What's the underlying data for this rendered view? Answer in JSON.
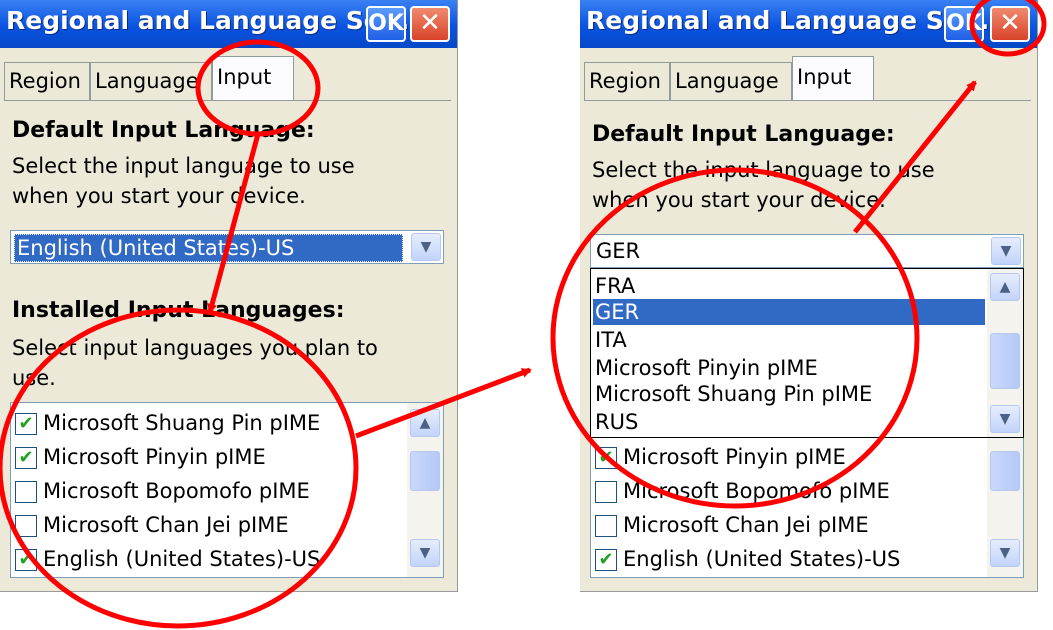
{
  "left": {
    "title": "Regional and Language Se...",
    "ok_label": "OK",
    "close_glyph": "✕",
    "tabs": [
      {
        "label": "Region"
      },
      {
        "label": "Language"
      },
      {
        "label": "Input"
      }
    ],
    "default_heading": "Default Input Language:",
    "default_desc_1": "Select the input language to use",
    "default_desc_2": "when you start your device.",
    "combo_value": "English (United States)-US",
    "installed_heading": "Installed Input Languages:",
    "installed_desc_1": "Select input languages you plan to",
    "installed_desc_2": "use.",
    "items": [
      {
        "label": "Microsoft Shuang Pin pIME",
        "checked": "✔"
      },
      {
        "label": "Microsoft Pinyin pIME",
        "checked": "✔"
      },
      {
        "label": "Microsoft Bopomofo pIME",
        "checked": ""
      },
      {
        "label": "Microsoft Chan Jei pIME",
        "checked": ""
      },
      {
        "label": "English (United States)-US",
        "checked": "✔"
      }
    ]
  },
  "right": {
    "title": "Regional and Language Se...",
    "ok_label": "OK",
    "close_glyph": "✕",
    "tabs": [
      {
        "label": "Region"
      },
      {
        "label": "Language"
      },
      {
        "label": "Input"
      }
    ],
    "default_heading": "Default Input Language:",
    "default_desc_1": "Select the input language to use",
    "default_desc_2": "when you start your device.",
    "combo_value": "GER",
    "dropdown_options": [
      {
        "label": "FRA"
      },
      {
        "label": "GER"
      },
      {
        "label": "ITA"
      },
      {
        "label": "Microsoft Pinyin pIME"
      },
      {
        "label": "Microsoft Shuang Pin pIME"
      },
      {
        "label": "RUS"
      }
    ],
    "items": [
      {
        "label": "Microsoft Pinyin pIME",
        "checked": "✔"
      },
      {
        "label": "Microsoft Bopomofo pIME",
        "checked": ""
      },
      {
        "label": "Microsoft Chan Jei pIME",
        "checked": ""
      },
      {
        "label": "English (United States)-US",
        "checked": "✔"
      }
    ]
  },
  "icons": {
    "scroll_up": "▲",
    "scroll_down": "▼",
    "combo_arrow": "▼"
  },
  "colors": {
    "titlebar": "#0A53E0",
    "annotation": "#FF0000",
    "selection": "#316AC5",
    "dialog_bg": "#ECE9D8"
  }
}
